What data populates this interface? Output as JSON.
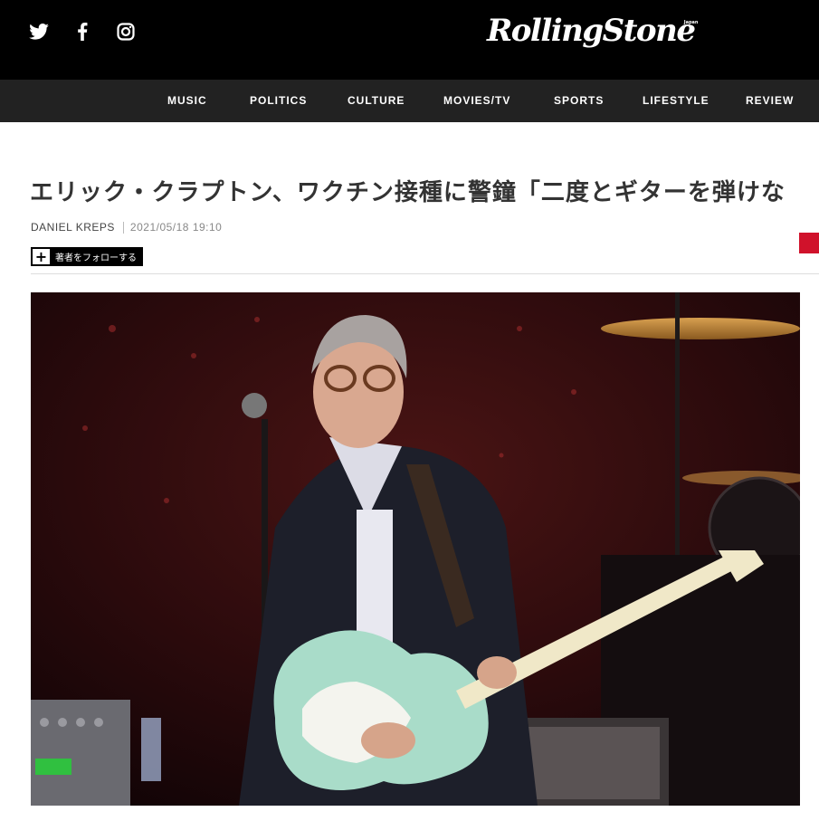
{
  "header": {
    "logo_text": "RollingStone",
    "logo_sub": "Japan",
    "social": [
      "twitter-icon",
      "facebook-icon",
      "instagram-icon"
    ]
  },
  "nav": {
    "items": [
      {
        "label": "MUSIC"
      },
      {
        "label": "POLITICS"
      },
      {
        "label": "CULTURE"
      },
      {
        "label": "MOVIES/TV"
      },
      {
        "label": "SPORTS"
      },
      {
        "label": "LIFESTYLE"
      },
      {
        "label": "REVIEW"
      }
    ]
  },
  "article": {
    "title": "エリック・クラプトン、ワクチン接種に警鐘「二度とギターを弾けな",
    "author": "DANIEL KREPS",
    "date": "2021/05/18 19:10",
    "follow_label": "著者をフォローする",
    "follow_icon": "+"
  },
  "colors": {
    "header_bg": "#000000",
    "nav_bg": "#222222",
    "accent": "#d0122b"
  }
}
